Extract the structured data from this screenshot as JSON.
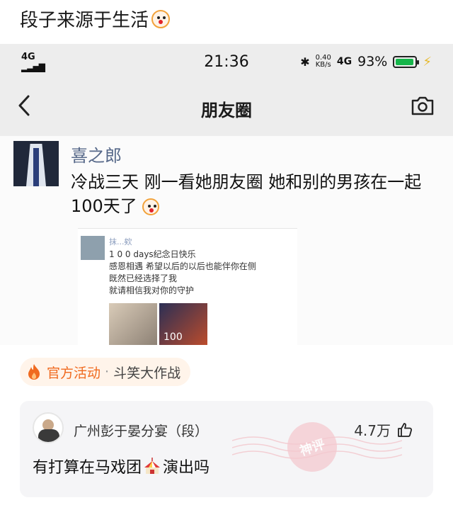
{
  "post": {
    "title": "段子来源于生活",
    "title_emoji": "clown-face-icon"
  },
  "phone": {
    "status": {
      "left_indicator": "4G",
      "time": "21:36",
      "speed_top": "0.40",
      "speed_bottom": "KB/s",
      "network": "4G",
      "battery_percent": "93%",
      "battery_level": 0.93
    },
    "nav": {
      "title": "朋友圈",
      "back_icon": "chevron-left-icon",
      "camera_icon": "camera-icon"
    },
    "moment": {
      "name": "喜之郎",
      "text": "冷战三天 刚一看她朋友圈 她和别的男孩在一起100天了",
      "inner": {
        "name": "抹...欸",
        "lines": "1 0 0 days纪念日快乐\n感恩相遇 希望以后的以后也能伴你在侧\n既然已经选择了我\n就请相信我对你的守护",
        "thumb_label": "100"
      }
    }
  },
  "activity": {
    "label": "官方活动",
    "separator": "·",
    "subtitle": "斗笑大作战"
  },
  "comment": {
    "author": "广州彭于晏分宴（段）",
    "likes": "4.7万",
    "text": "有打算在马戏团",
    "text_tail": "演出吗",
    "stamp": "神评"
  },
  "colors": {
    "accent_orange": "#f06a1f",
    "link_blue": "#566889",
    "battery_green": "#16b54a"
  }
}
